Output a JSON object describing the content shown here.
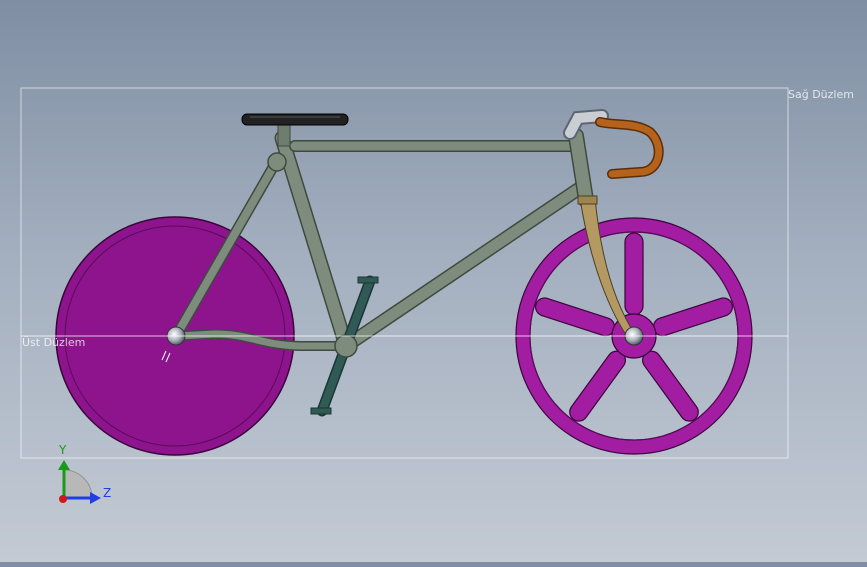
{
  "planes": {
    "right_plane_label": "Sağ Düzlem",
    "top_plane_label": "Üst Düzlem"
  },
  "triad": {
    "y_label": "Y",
    "z_label": "Z"
  },
  "colors": {
    "frame": "#7d8c7c",
    "wheels": "#8e148e",
    "seat": "#222222",
    "handlebar_tape": "#b5621c",
    "fork": "#b49a62",
    "crank": "#2f5a56",
    "axis_y": "#1a9a1a",
    "axis_z": "#1f3fe0",
    "axis_x": "#d01818"
  }
}
